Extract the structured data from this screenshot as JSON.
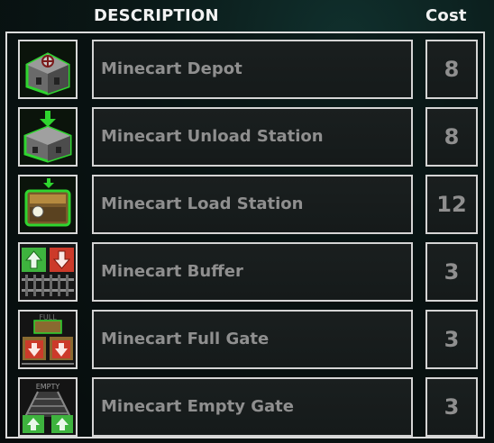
{
  "header": {
    "description": "DESCRIPTION",
    "cost": "Cost"
  },
  "items": [
    {
      "name": "Minecart Depot",
      "cost": "8",
      "icon": "minecart-depot-icon"
    },
    {
      "name": "Minecart Unload Station",
      "cost": "8",
      "icon": "minecart-unload-station-icon"
    },
    {
      "name": "Minecart Load Station",
      "cost": "12",
      "icon": "minecart-load-station-icon"
    },
    {
      "name": "Minecart Buffer",
      "cost": "3",
      "icon": "minecart-buffer-icon"
    },
    {
      "name": "Minecart Full Gate",
      "cost": "3",
      "icon": "minecart-full-gate-icon",
      "icon_text": "FULL"
    },
    {
      "name": "Minecart Empty Gate",
      "cost": "3",
      "icon": "minecart-empty-gate-icon",
      "icon_text": "EMPTY"
    }
  ],
  "colors": {
    "accent_green": "#2fd52f",
    "arrow_red": "#d42a1a",
    "text_gray": "#8f8f8f",
    "border": "#d4d4d4"
  }
}
